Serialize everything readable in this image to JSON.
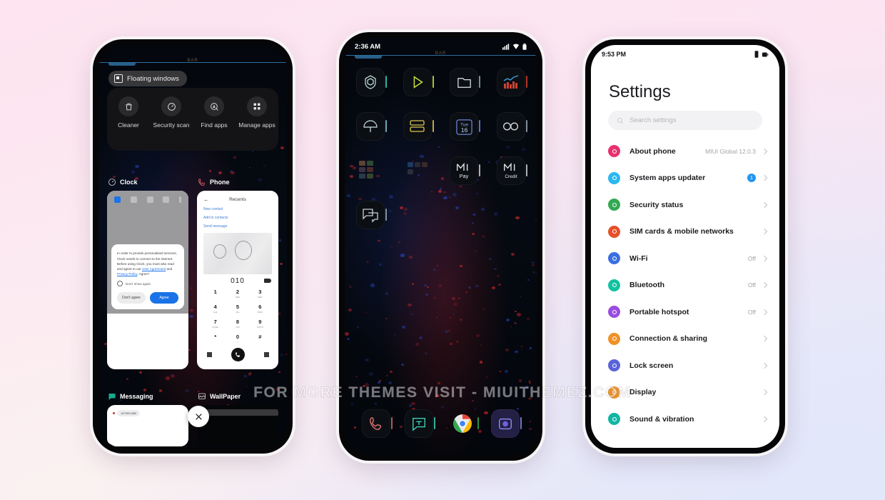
{
  "watermark": "FOR MORE THEMES VISIT - MIUITHEMEZ.COM",
  "background": {
    "top_left": "#FCE6F0",
    "top_right": "#FDE0EF",
    "bottom_left": "#FDF3EF",
    "bottom_right": "#E2E7F9"
  },
  "phone_left": {
    "status_bar_label": "BAR",
    "floating_windows_chip": "Floating windows",
    "quick_actions": [
      {
        "label": "Cleaner",
        "icon": "trash-icon"
      },
      {
        "label": "Security scan",
        "icon": "shield-speed-icon"
      },
      {
        "label": "Find apps",
        "icon": "find-apps-icon"
      },
      {
        "label": "Manage apps",
        "icon": "grid-apps-icon"
      }
    ],
    "cards": [
      {
        "app": "Clock",
        "icon": "clock-icon"
      },
      {
        "app": "Phone",
        "icon": "phone-icon"
      }
    ],
    "clock_card": {
      "dialog_text": "In order to provide personalised services, Clock needs to connect to the internet. Before using Clock, you must also read and agree to our ",
      "link_user_agreement": "User Agreement",
      "dialog_text_mid": " and ",
      "link_privacy_policy": "Privacy Policy",
      "dialog_text_end": ". Agree?",
      "checkbox_label": "Don't show again",
      "decline_button": "Don't agree",
      "accept_button": "Agree"
    },
    "phone_card": {
      "back_icon": "back-arrow-icon",
      "title": "Recents",
      "links": [
        "New contact",
        "Add to contacts",
        "Send message"
      ],
      "dialed_number": "010",
      "keys": [
        {
          "digit": "1",
          "sub": ""
        },
        {
          "digit": "2",
          "sub": "ABC"
        },
        {
          "digit": "3",
          "sub": "DEF"
        },
        {
          "digit": "4",
          "sub": "GHI"
        },
        {
          "digit": "5",
          "sub": "JKL"
        },
        {
          "digit": "6",
          "sub": "MNO"
        },
        {
          "digit": "7",
          "sub": "PQRS"
        },
        {
          "digit": "8",
          "sub": "TUV"
        },
        {
          "digit": "9",
          "sub": "WXYZ"
        },
        {
          "digit": "*",
          "sub": ""
        },
        {
          "digit": "0",
          "sub": "+"
        },
        {
          "digit": "#",
          "sub": ""
        }
      ]
    },
    "bottom_cards": [
      {
        "app": "Messaging",
        "icon": "messaging-icon",
        "pill_text": "1873521889"
      },
      {
        "app": "WallPaper",
        "icon": "wallpaper-icon"
      }
    ],
    "close_button": "close-icon"
  },
  "phone_mid": {
    "clock": "2:36 AM",
    "status_bar_label": "BAR",
    "status_icons": [
      "signal-icon",
      "wifi-icon",
      "battery-icon"
    ],
    "grid_rows": [
      [
        "security-icon",
        "play-store-icon",
        "file-manager-icon",
        "equalizer-icon"
      ],
      [
        "weather-icon",
        "notes-icon",
        "calendar-icon",
        "mi-browser-icon"
      ],
      [
        "tools-folder-icon",
        "social-folder-icon",
        "mi-pay-icon",
        "mi-credit-icon"
      ],
      [
        "messages-alt-icon"
      ]
    ],
    "calendar_day_label": "Tue",
    "calendar_date": "16",
    "mi_pay_label": "Mi Pay",
    "mi_credit_label": "Mi Credit",
    "dock": [
      "phone-icon",
      "messages-icon",
      "chrome-icon",
      "camera-icon"
    ]
  },
  "phone_right": {
    "clock": "9:53 PM",
    "status_icons": [
      "vibrate-icon",
      "battery-icon"
    ],
    "title": "Settings",
    "search_placeholder": "Search settings",
    "search_icon": "search-icon",
    "items": [
      {
        "label": "About phone",
        "value": "MIUI Global 12.0.3",
        "badge": "",
        "color": "#e8316d",
        "icon": "about-phone-icon"
      },
      {
        "label": "System apps updater",
        "value": "",
        "badge": "1",
        "color": "#2bb8f0",
        "icon": "updater-icon"
      },
      {
        "label": "Security status",
        "value": "",
        "badge": "",
        "color": "#34a853",
        "icon": "security-icon"
      },
      {
        "label": "SIM cards & mobile networks",
        "value": "",
        "badge": "",
        "color": "#e8502a",
        "icon": "sim-card-icon"
      },
      {
        "label": "Wi-Fi",
        "value": "Off",
        "badge": "",
        "color": "#3b6fe0",
        "icon": "wifi-icon"
      },
      {
        "label": "Bluetooth",
        "value": "Off",
        "badge": "",
        "color": "#12c2a0",
        "icon": "bluetooth-icon"
      },
      {
        "label": "Portable hotspot",
        "value": "Off",
        "badge": "",
        "color": "#9a4ce0",
        "icon": "hotspot-icon"
      },
      {
        "label": "Connection & sharing",
        "value": "",
        "badge": "",
        "color": "#ef9126",
        "icon": "sharing-icon"
      },
      {
        "label": "Lock screen",
        "value": "",
        "badge": "",
        "color": "#5a63d8",
        "icon": "lock-screen-icon"
      },
      {
        "label": "Display",
        "value": "",
        "badge": "",
        "color": "#e8902a",
        "icon": "display-icon"
      },
      {
        "label": "Sound & vibration",
        "value": "",
        "badge": "",
        "color": "#12b5a4",
        "icon": "sound-icon"
      }
    ]
  }
}
